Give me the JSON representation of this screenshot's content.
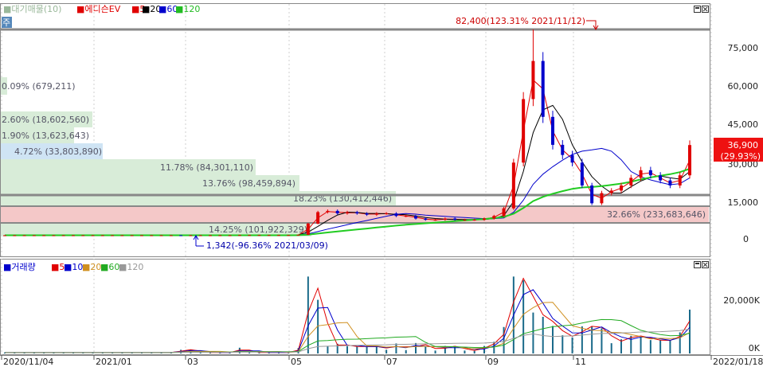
{
  "price_pane": {
    "legend": [
      {
        "text": "■대기매물(10)",
        "color": "#9ab89a"
      },
      {
        "text": "■에디슨EV",
        "color": "#e00000"
      },
      {
        "text": "■5",
        "color": "#e00000"
      },
      {
        "text": "■20",
        "color": "#000000"
      },
      {
        "text": "■60",
        "color": "#0000cc"
      },
      {
        "text": "■120",
        "color": "#22bb22"
      }
    ],
    "corner_tag": "주",
    "y_ticks": [
      "75,000",
      "60,000",
      "45,000",
      "30,000",
      "15,000",
      "0"
    ],
    "current_price": "36,900",
    "current_change": "(29.93%)",
    "high_annotation": "82,400(123.31% 2021/11/12)",
    "low_annotation": "1,342(-96.36% 2021/03/09)"
  },
  "volume_profile": [
    {
      "label": "0.09% (679,211)"
    },
    {
      "label": "2.60% (18,602,560)"
    },
    {
      "label": "1.90% (13,623,643)"
    },
    {
      "label": "4.72% (33,803,890)"
    },
    {
      "label": "11.78% (84,301,110)"
    },
    {
      "label": "13.76% (98,459,894)"
    },
    {
      "label": "18.23% (130,412,446)"
    },
    {
      "label": "32.66% (233,683,646)"
    },
    {
      "label": "14.25% (101,922,329)"
    }
  ],
  "volume_pane": {
    "legend": [
      {
        "text": "■거래량",
        "color": "#0000cc"
      },
      {
        "text": "■5",
        "color": "#e00000"
      },
      {
        "text": "■10",
        "color": "#0000cc"
      },
      {
        "text": "■20",
        "color": "#d09020"
      },
      {
        "text": "■60",
        "color": "#22aa22"
      },
      {
        "text": "■120",
        "color": "#999999"
      }
    ],
    "y_ticks": [
      "20,000K",
      "0K"
    ]
  },
  "x_ticks": [
    "2020/11/04",
    "2021/01",
    "03",
    "05",
    "07",
    "09",
    "11",
    "2022/01/18"
  ],
  "chart_data": {
    "type": "candlestick",
    "x_start": "2020/11/04",
    "x_end": "2022/01/18",
    "y_range": [
      0,
      85000
    ],
    "weekly_close_approx": [
      1400,
      1400,
      1400,
      1400,
      1400,
      1400,
      1400,
      1400,
      1400,
      1400,
      1400,
      1400,
      1400,
      1400,
      1400,
      1400,
      1400,
      1400,
      1342,
      1400,
      1400,
      1400,
      1400,
      1400,
      1500,
      1500,
      1500,
      1500,
      1500,
      1500,
      1600,
      6000,
      10500,
      11000,
      10000,
      10500,
      10000,
      9500,
      10000,
      10000,
      9000,
      9000,
      8000,
      7500,
      7500,
      8000,
      7500,
      7500,
      7500,
      8000,
      9000,
      12000,
      30000,
      55000,
      70000,
      48000,
      37000,
      33000,
      30000,
      21000,
      14000,
      18000,
      19000,
      21000,
      24000,
      27000,
      25000,
      23000,
      21000,
      25000,
      36900
    ],
    "high": {
      "value": 82400,
      "change_pct": 123.31,
      "date": "2021/11/12"
    },
    "low": {
      "value": 1342,
      "change_pct": -96.36,
      "date": "2021/03/09"
    },
    "last": {
      "value": 36900,
      "change_pct": 29.93
    },
    "volume_profile": [
      {
        "pct": 0.09,
        "volume": 679211
      },
      {
        "pct": 2.6,
        "volume": 18602560
      },
      {
        "pct": 1.9,
        "volume": 13623643
      },
      {
        "pct": 4.72,
        "volume": 33803890
      },
      {
        "pct": 11.78,
        "volume": 84301110
      },
      {
        "pct": 13.76,
        "volume": 98459894
      },
      {
        "pct": 18.23,
        "volume": 130412446
      },
      {
        "pct": 32.66,
        "volume": 233683646
      },
      {
        "pct": 14.25,
        "volume": 101922329
      }
    ],
    "volume_y_range": [
      0,
      30000
    ]
  }
}
